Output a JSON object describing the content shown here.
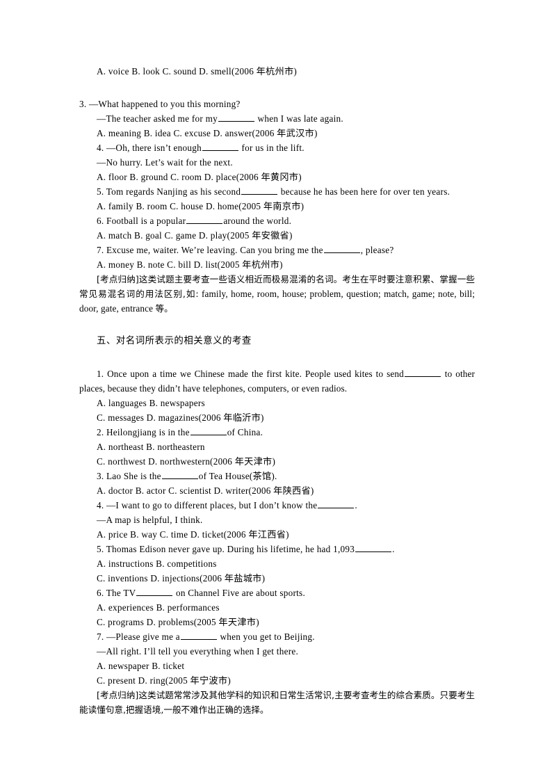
{
  "document": {
    "page_background": "#ffffff",
    "text_color": "#000000"
  },
  "block_one": {
    "line_1": "A. voice B. look C. sound D. smell(2006 年杭州市)",
    "q3_stem": "3. —What happened to you this morning?",
    "q3_reply_pre": "—The teacher asked me for my",
    "q3_reply_post": " when I was late again.",
    "q3_options": "A. meaning B. idea C. excuse D. answer(2006 年武汉市)",
    "q4_stem_pre": "4. —Oh, there isn’t enough",
    "q4_stem_post": " for us in the lift.",
    "q4_reply": "—No hurry. Let’s wait for the next.",
    "q4_options": "A. floor B. ground C. room D. place(2006 年黄冈市)",
    "q5_stem_pre": "5. Tom regards Nanjing as his second",
    "q5_stem_post": " because he has been here for over ten years.",
    "q5_options": "A. family B. room C. house D. home(2005 年南京市)",
    "q6_stem_pre": "6. Football is a popular",
    "q6_stem_post": "around the world.",
    "q6_options": "A. match B. goal C. game D. play(2005 年安徽省)",
    "q7_stem_pre": "7. Excuse me, waiter. We’re leaving. Can you bring me the",
    "q7_stem_post": ", please?",
    "q7_options": "A. money B. note C. bill D. list(2005 年杭州市)",
    "note_label": "[考点归纳]",
    "note_text_cn_1": "这类试题主要考查一些语义相近而极易混淆的名词。考生在平时要注意积累、掌握一些常见易混名词的用法区别,如:",
    "note_text_en": " family, home, room, house; problem, question; match, game; note, bill; door, gate, entrance ",
    "note_text_cn_2": "等。"
  },
  "section_five": {
    "heading": "五、对名词所表示的相关意义的考查",
    "q1_text_pre": "1. Once upon a time we Chinese made the first kite. People used kites to send",
    "q1_text_post": " to other places, because they didn’t have telephones, computers, or even radios.",
    "q1_options_ab": "A. languages B. newspapers",
    "q1_options_cd": "C. messages D. magazines(2006 年临沂市)",
    "q2_stem_pre": "2. Heilongjiang is in the",
    "q2_stem_post": "of China.",
    "q2_options_ab": "A. northeast B. northeastern",
    "q2_options_cd": "C. northwest D. northwestern(2006 年天津市)",
    "q3_stem_pre": "3. Lao She is the",
    "q3_stem_post": "of Tea House(茶馆).",
    "q3_options": "A. doctor B. actor C. scientist D. writer(2006 年陕西省)",
    "q4_stem_pre": "4. —I want to go to different places, but I don’t know the",
    "q4_stem_post": ".",
    "q4_reply": "—A map is helpful, I think.",
    "q4_options": "A. price B. way C. time D. ticket(2006 年江西省)",
    "q5_stem_pre": "5. Thomas Edison never gave up. During his lifetime, he had 1,093",
    "q5_stem_post": ".",
    "q5_options_ab": "A. instructions B. competitions",
    "q5_options_cd": "C. inventions D. injections(2006 年盐城市)",
    "q6_stem_pre": "6. The TV",
    "q6_stem_post": " on Channel Five are about sports.",
    "q6_options_ab": "A. experiences B. performances",
    "q6_options_cd": "C. programs D. problems(2005 年天津市)",
    "q7_stem_pre": "7. —Please give me a",
    "q7_stem_post": " when you get to Beijing.",
    "q7_reply": "—All right. I’ll tell you everything when I get there.",
    "q7_options_ab": "A. newspaper B. ticket",
    "q7_options_cd": "C. present D. ring(2005 年宁波市)",
    "note_label": "[考点归纳]",
    "note_text": "这类试题常常涉及其他学科的知识和日常生活常识,主要考查考生的综合素质。只要考生能读懂句意,把握语境,一般不难作出正确的选择。"
  }
}
